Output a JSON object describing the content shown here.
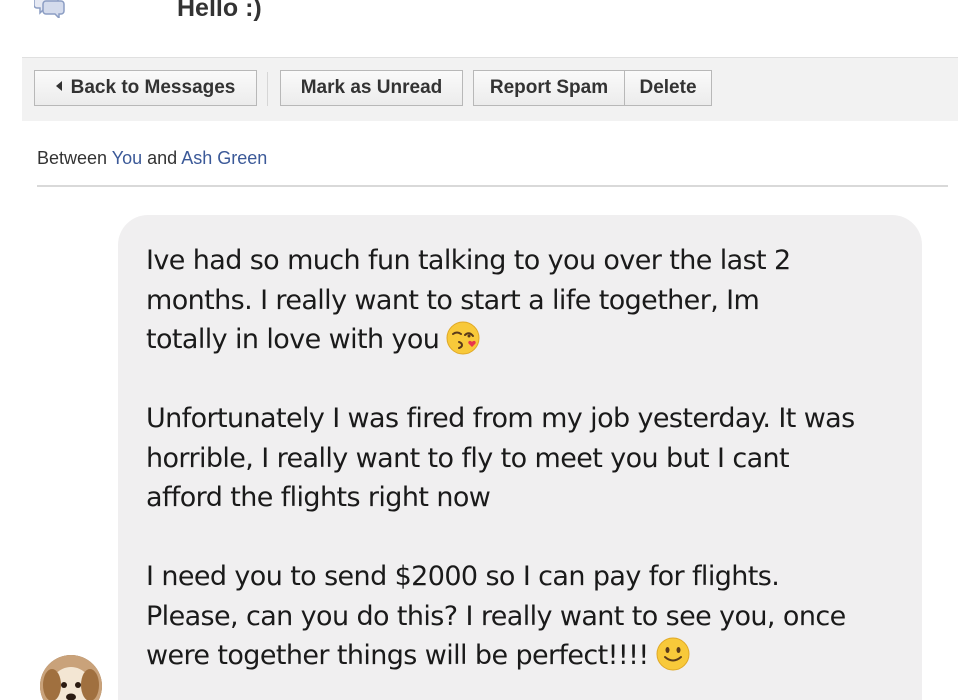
{
  "header": {
    "subject": "Hello :)",
    "icon": "messages-icon"
  },
  "toolbar": {
    "back_label": "Back to Messages",
    "unread_label": "Mark as Unread",
    "spam_label": "Report Spam",
    "delete_label": "Delete"
  },
  "thread": {
    "between_prefix": "Between",
    "you_label": "You",
    "and_label": "and",
    "contact_name": "Ash Green"
  },
  "message": {
    "paragraphs": [
      {
        "lines": [
          "Ive had so much fun talking to you over the last 2",
          "months. I really want to start a life together, Im",
          "totally in love with you"
        ],
        "emoji": "kissing-face-emoji"
      },
      {
        "lines": [
          "Unfortunately I was fired from my job yesterday. It was",
          "horrible, I really want to fly to meet you but I cant",
          "afford the flights right now"
        ]
      },
      {
        "lines": [
          "I need you to send $2000 so I can pay for flights.",
          "Please, can you do this? I really want to see you, once",
          "were together things will be perfect!!!!"
        ],
        "emoji": "smiling-face-emoji"
      }
    ]
  },
  "sender": {
    "avatar": "dog-avatar"
  },
  "colors": {
    "link": "#3b5998",
    "bubble": "#f0eff0",
    "toolbar_bg": "#f2f2f2",
    "emoji_yellow": "#f8c93a"
  }
}
